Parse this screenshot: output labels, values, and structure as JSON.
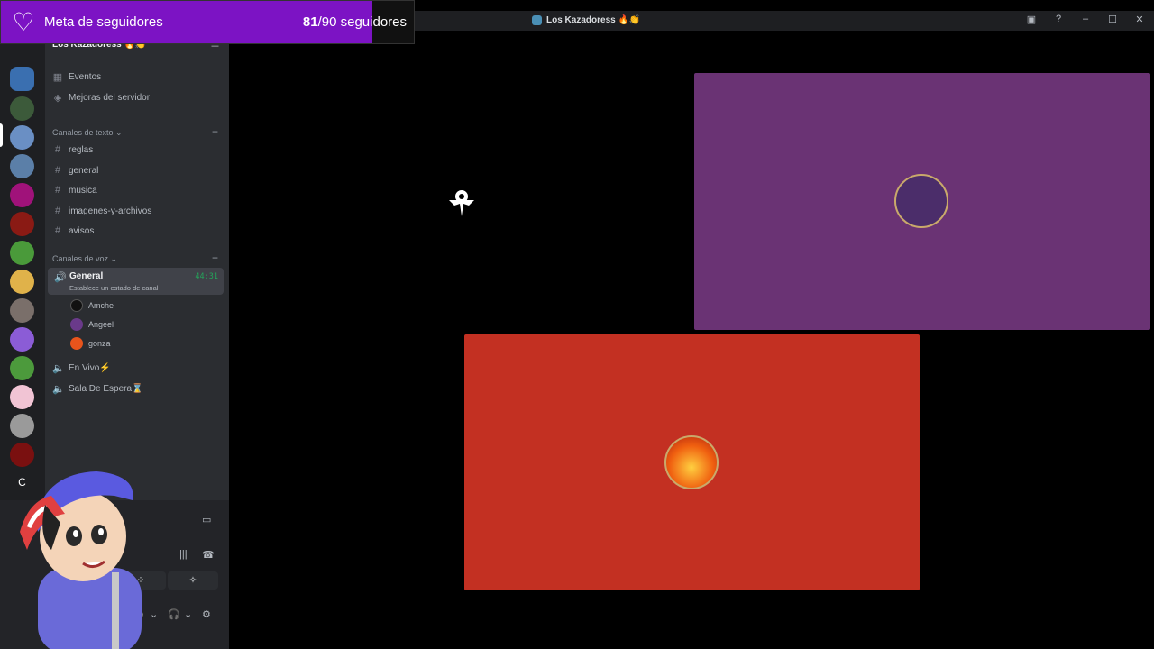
{
  "window": {
    "title": "Los Kazadoress 🔥👏"
  },
  "goal": {
    "label": "Meta de seguidores",
    "current": "81",
    "total": "/90 seguidores",
    "progress": 0.9
  },
  "server": {
    "name": "Los Kazadoress 🔥👏"
  },
  "sidebar": {
    "top_items": [
      {
        "label": "Eventos"
      },
      {
        "label": "Mejoras del servidor"
      }
    ],
    "text_category": "Canales de texto",
    "text_channels": [
      "reglas",
      "general",
      "musica",
      "imagenes-y-archivos",
      "avisos"
    ],
    "voice_category": "Canales de voz",
    "active_voice": {
      "name": "General",
      "status": "Establece un estado de canal",
      "timer": "44:31"
    },
    "members": [
      "Amche",
      "Angeel",
      "gonza"
    ],
    "other_voice": [
      "En Vivo⚡",
      "Sala De Espera⌛"
    ]
  },
  "rail": {
    "letter": "C"
  },
  "colors": {
    "accent": "#7c13c4",
    "voice_green": "#23a55a",
    "tile_purple": "#6a3374",
    "tile_red": "#c33022"
  }
}
